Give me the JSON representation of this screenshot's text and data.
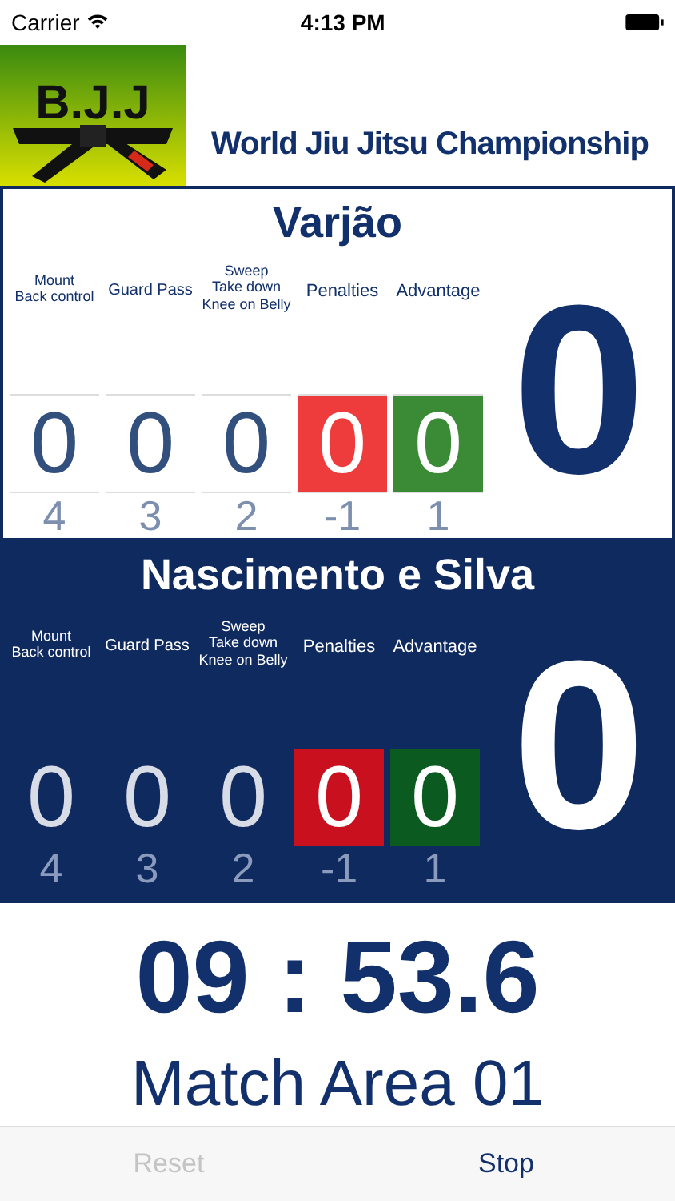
{
  "status_bar": {
    "carrier": "Carrier",
    "time": "4:13 PM"
  },
  "header": {
    "logo_text": "B.J.J",
    "title": "World Jiu Jitsu Championship"
  },
  "fighters": [
    {
      "name": "Varjão",
      "kind": "light",
      "total": "0",
      "columns": [
        {
          "kind": "plain",
          "label": [
            "Mount",
            "Back control"
          ],
          "value": "0",
          "next": "4"
        },
        {
          "kind": "plain",
          "label": [
            "Guard Pass"
          ],
          "value": "0",
          "next": "3"
        },
        {
          "kind": "plain",
          "label": [
            "Sweep",
            "Take down",
            "Knee on Belly"
          ],
          "value": "0",
          "next": "2"
        },
        {
          "kind": "penalty",
          "label": [
            "Penalties"
          ],
          "value": "0",
          "next": "-1"
        },
        {
          "kind": "advantage",
          "label": [
            "Advantage"
          ],
          "value": "0",
          "next": "1"
        }
      ]
    },
    {
      "name": "Nascimento e Silva",
      "kind": "dark",
      "total": "0",
      "columns": [
        {
          "kind": "plain",
          "label": [
            "Mount",
            "Back control"
          ],
          "value": "0",
          "next": "4"
        },
        {
          "kind": "plain",
          "label": [
            "Guard Pass"
          ],
          "value": "0",
          "next": "3"
        },
        {
          "kind": "plain",
          "label": [
            "Sweep",
            "Take down",
            "Knee on Belly"
          ],
          "value": "0",
          "next": "2"
        },
        {
          "kind": "penalty",
          "label": [
            "Penalties"
          ],
          "value": "0",
          "next": "-1"
        },
        {
          "kind": "advantage",
          "label": [
            "Advantage"
          ],
          "value": "0",
          "next": "1"
        }
      ]
    }
  ],
  "timer": "09 : 53.6",
  "match_area": "Match Area 01",
  "toolbar": [
    {
      "label": "Reset",
      "disabled": true
    },
    {
      "label": "Stop",
      "disabled": false
    }
  ]
}
